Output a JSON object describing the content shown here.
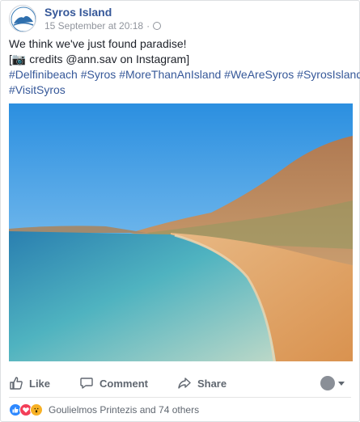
{
  "post": {
    "page_name": "Syros Island",
    "timestamp": "15 September at 20:18",
    "separator": "·",
    "text_line1": "We think we've just found paradise!",
    "text_line2_prefix": "[",
    "camera_emoji": "📷",
    "text_line2_rest": " credits @ann.sav on Instagram]",
    "hashtags_line1": [
      "#Delfinibeach",
      "#Syros",
      "#MoreThanAnIsland",
      "#WeAreSyros",
      "#SyrosIsland"
    ],
    "hashtags_line2": [
      "#VisitSyros"
    ]
  },
  "actions": {
    "like_label": "Like",
    "comment_label": "Comment",
    "share_label": "Share"
  },
  "reactions": {
    "summary": "Goulielmos Printezis and 74 others",
    "icons": [
      "like",
      "love",
      "wow"
    ]
  },
  "colors": {
    "link": "#365899",
    "like_blue": "#2d88ff",
    "love_red": "#f33e58",
    "wow_yellow": "#f7b125"
  }
}
